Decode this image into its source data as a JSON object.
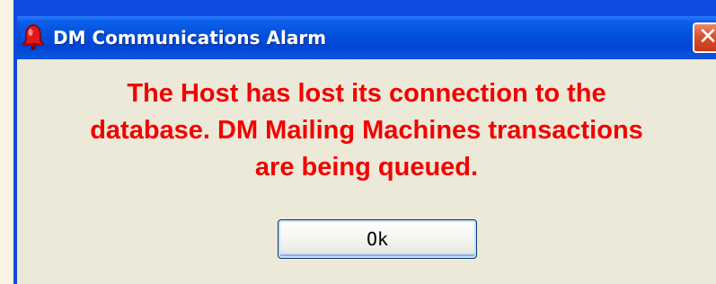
{
  "window": {
    "title": "DM Communications Alarm",
    "title_icon": "alarm-bell-icon",
    "close_icon": "close-icon",
    "close_glyph": "✕"
  },
  "message": {
    "lines": [
      "The Host has lost its connection to the",
      "database. DM Mailing Machines transactions",
      "are being queued."
    ]
  },
  "buttons": {
    "ok_label": "Ok"
  },
  "colors": {
    "message_text": "#F20000",
    "titlebar": "#0352DE",
    "client_background": "#ECE9D8",
    "close_button": "#D8512E"
  }
}
